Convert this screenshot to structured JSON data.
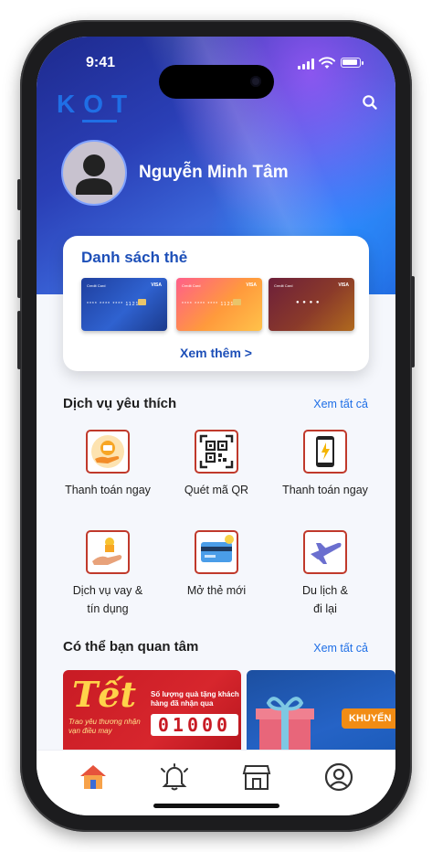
{
  "status": {
    "time": "9:41"
  },
  "header": {
    "logo": "KOT"
  },
  "profile": {
    "name": "Nguyễn Minh Tâm"
  },
  "card_list": {
    "title": "Danh sách thẻ",
    "more_label": "Xem thêm >",
    "cards": [
      {
        "brand": "VISA",
        "label": "Credit Card",
        "number": "**** **** **** 1121",
        "color": "#2a52b8"
      },
      {
        "brand": "VISA",
        "label": "Credit Card",
        "number": "**** **** **** 1121",
        "color": "#f6a33a"
      },
      {
        "brand": "VISA",
        "label": "Credit Card",
        "number": "● ● ● ●",
        "color": "#8a2e3a"
      }
    ]
  },
  "favorites": {
    "title": "Dịch vụ yêu thích",
    "see_all": "Xem tất cả",
    "items": [
      {
        "label": "Thanh toán ngay",
        "icon": "payment-hand-icon"
      },
      {
        "label": "Quét mã QR",
        "icon": "qr-code-icon"
      },
      {
        "label": "Thanh toán ngay",
        "icon": "mobile-payment-icon"
      },
      {
        "label": "Dịch vụ vay & tín dụng",
        "line1": "Dịch vụ vay &",
        "line2": "tín dụng",
        "icon": "loan-icon"
      },
      {
        "label": "Mở thẻ mới",
        "icon": "new-card-icon"
      },
      {
        "label": "Du lịch & đi lại",
        "line1": "Du lịch &",
        "line2": "đi lại",
        "icon": "airplane-icon"
      }
    ]
  },
  "interest": {
    "title": "Có thể bạn quan tâm",
    "see_all": "Xem tất cả",
    "banners": [
      {
        "headline": "Tết",
        "tagline": "Trao yêu thương nhận vạn điều may",
        "subtitle": "Số lượng quà tặng khách hàng đã nhận qua",
        "counter": "01000"
      },
      {
        "badge": "KHUYẾN"
      }
    ]
  },
  "tabbar": {
    "items": [
      "home-icon",
      "bell-icon",
      "store-icon",
      "profile-icon"
    ]
  }
}
